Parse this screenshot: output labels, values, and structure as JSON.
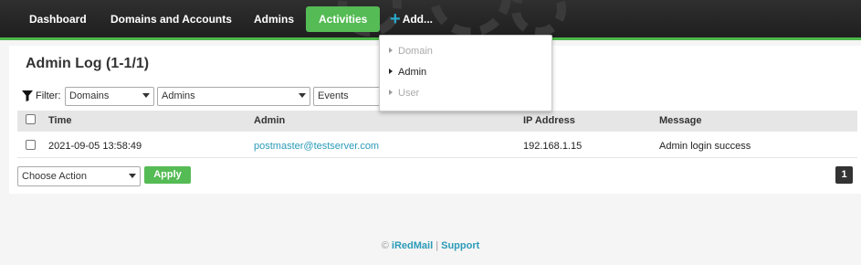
{
  "nav": {
    "items": [
      {
        "label": "Dashboard"
      },
      {
        "label": "Domains and Accounts"
      },
      {
        "label": "Admins"
      },
      {
        "label": "Activities"
      }
    ],
    "add_label": "Add...",
    "accent": "#55bb55"
  },
  "add_menu": {
    "items": [
      {
        "label": "Domain",
        "enabled": false
      },
      {
        "label": "Admin",
        "enabled": true
      },
      {
        "label": "User",
        "enabled": false
      }
    ]
  },
  "page": {
    "title": "Admin Log (1-1/1)"
  },
  "filter": {
    "label": "Filter:",
    "domains_value": "Domains",
    "admins_value": "Admins",
    "events_value": "Events"
  },
  "table": {
    "columns": [
      "Time",
      "Admin",
      "IP Address",
      "Message"
    ],
    "rows": [
      {
        "time": "2021-09-05 13:58:49",
        "admin": "postmaster@testserver.com",
        "ip": "192.168.1.15",
        "message": "Admin login success"
      }
    ]
  },
  "actions": {
    "select_value": "Choose Action",
    "apply_label": "Apply",
    "page_number": "1"
  },
  "footer": {
    "copyright": "©",
    "brand": "iRedMail",
    "separator": "|",
    "support": "Support"
  }
}
